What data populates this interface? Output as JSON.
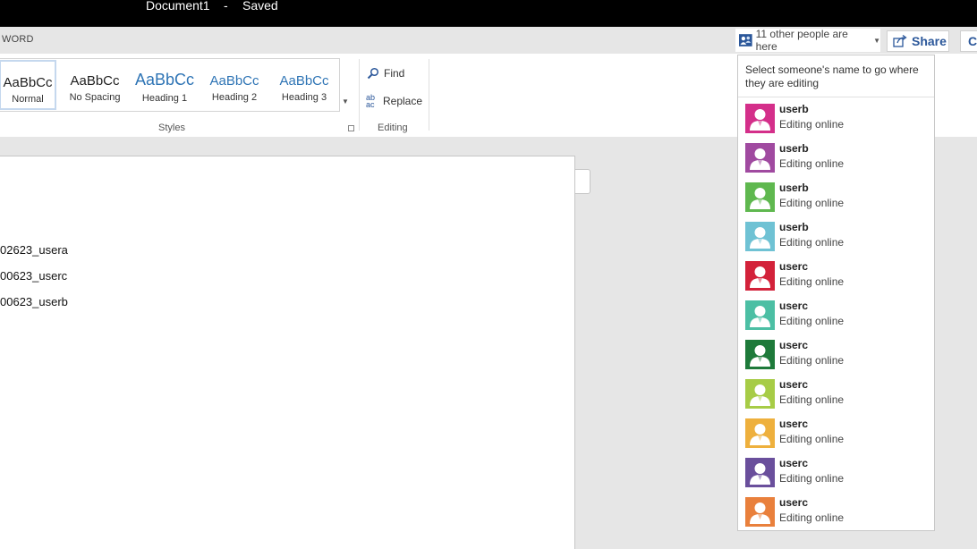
{
  "titlebar": {
    "document": "Document1",
    "separator": "-",
    "save_state": "Saved"
  },
  "app": {
    "name": "WORD"
  },
  "header": {
    "people_button": "11 other people are here",
    "share_label": "Share",
    "comments_label": "Co"
  },
  "ribbon": {
    "styles": [
      {
        "preview": "AaBbCc",
        "label": "Normal"
      },
      {
        "preview": "AaBbCc",
        "label": "No Spacing"
      },
      {
        "preview": "AaBbCc",
        "label": "Heading 1"
      },
      {
        "preview": "AaBbCc",
        "label": "Heading 2"
      },
      {
        "preview": "AaBbCc",
        "label": "Heading 3"
      }
    ],
    "styles_group_label": "Styles",
    "editing": {
      "find_label": "Find",
      "replace_label": "Replace",
      "replace_icon": "ab ac",
      "group_label": "Editing"
    }
  },
  "document_lines": [
    "02623_usera",
    "00623_userc",
    "00623_userb"
  ],
  "people_panel": {
    "hint": "Select someone's name to go where they are editing",
    "people": [
      {
        "name": "userb",
        "status": "Editing online",
        "color": "#d42f8a"
      },
      {
        "name": "userb",
        "status": "Editing online",
        "color": "#a04aa0"
      },
      {
        "name": "userb",
        "status": "Editing online",
        "color": "#5fb84f"
      },
      {
        "name": "userb",
        "status": "Editing online",
        "color": "#6fc2d4"
      },
      {
        "name": "userc",
        "status": "Editing online",
        "color": "#d3223a"
      },
      {
        "name": "userc",
        "status": "Editing online",
        "color": "#4cbfa4"
      },
      {
        "name": "userc",
        "status": "Editing online",
        "color": "#1e7a3a"
      },
      {
        "name": "userc",
        "status": "Editing online",
        "color": "#a7cc46"
      },
      {
        "name": "userc",
        "status": "Editing online",
        "color": "#eeb03d"
      },
      {
        "name": "userc",
        "status": "Editing online",
        "color": "#6a4f9c"
      },
      {
        "name": "userc",
        "status": "Editing online",
        "color": "#e9803c"
      }
    ]
  },
  "colors": {
    "accent": "#2b579a",
    "titlebar": "#000000"
  },
  "icons": {
    "people": "people-icon",
    "share": "share-icon",
    "find": "find-icon",
    "replace": "replace-icon",
    "avatar": "person-silhouette-icon"
  }
}
